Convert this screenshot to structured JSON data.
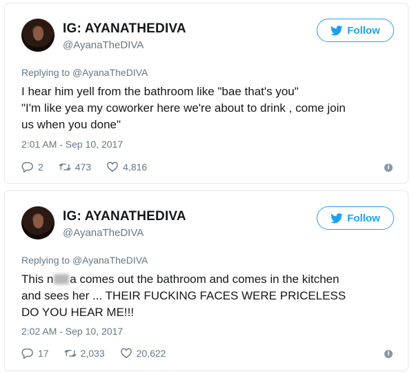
{
  "tweets": [
    {
      "display_name": "IG: AYANATHEDIVA",
      "handle": "@AyanaTheDIVA",
      "follow_label": "Follow",
      "reply_prefix": "Replying to",
      "reply_mention": "@AyanaTheDIVA",
      "lines": [
        "I hear him yell from the bathroom like \"bae that's you\"",
        "\"I'm like yea my coworker here we're about to drink , come join",
        "us when you done\""
      ],
      "timestamp": "2:01 AM - Sep 10, 2017",
      "replies": "2",
      "retweets": "473",
      "likes": "4,816"
    },
    {
      "display_name": "IG: AYANATHEDIVA",
      "handle": "@AyanaTheDIVA",
      "follow_label": "Follow",
      "reply_prefix": "Replying to",
      "reply_mention": "@AyanaTheDIVA",
      "line1_start": "This n",
      "line1_end": "a comes out the bathroom and comes in the kitchen",
      "line2": "and sees her ... THEIR FUCKING FACES WERE PRICELESS",
      "line3": "DO YOU HEAR ME!!!",
      "timestamp": "2:02 AM - Sep 10, 2017",
      "replies": "17",
      "retweets": "2,033",
      "likes": "20,622"
    }
  ],
  "colors": {
    "accent": "#1da1f2",
    "muted": "#657786",
    "text": "#14171a",
    "border": "#e1e8ed"
  },
  "icons": [
    "twitter-bird-icon",
    "reply-icon",
    "retweet-icon",
    "like-icon",
    "info-icon"
  ]
}
